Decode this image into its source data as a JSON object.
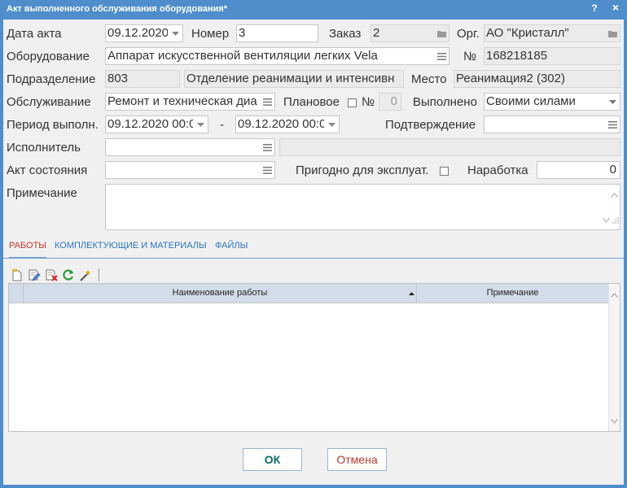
{
  "window": {
    "title": "Акт выполненного обслуживания оборудования*",
    "help": "?",
    "close": "×"
  },
  "labels": {
    "act_date": "Дата акта",
    "number": "Номер",
    "order": "Заказ",
    "org": "Орг.",
    "equipment": "Оборудование",
    "serial_no": "№",
    "department": "Подразделение",
    "place": "Место",
    "service": "Обслуживание",
    "planned": "Плановое",
    "planned_no": "№",
    "performed": "Выполнено",
    "period": "Период выполн.",
    "dash": "-",
    "confirmation": "Подтверждение",
    "executor": "Исполнитель",
    "state_act": "Акт состояния",
    "fit": "Пригодно для эксплуат.",
    "operating_time": "Наработка",
    "note": "Примечание"
  },
  "values": {
    "act_date": "09.12.2020",
    "number": "3",
    "order": "2",
    "org": "АО \"Кристалл\"",
    "equipment": "Аппарат искусственной вентиляции легких Vela",
    "serial_no": "168218185",
    "department_code": "803",
    "department_name": "Отделение  реанимации и интенсивн",
    "place": "Реанимация2 (302)",
    "service": "Ремонт и техническая диа",
    "planned_no": "0",
    "performed": "Своими силами",
    "period_from": "09.12.2020 00:0",
    "period_to": "09.12.2020 00:0",
    "confirmation": "",
    "executor": "",
    "executor_info": "",
    "state_act": "",
    "operating_time": "0",
    "note": "",
    "planned_checked": false,
    "fit_checked": false
  },
  "tabs": [
    {
      "label": "РАБОТЫ",
      "active": true
    },
    {
      "label": "КОМПЛЕКТУЮЩИЕ И МАТЕРИАЛЫ",
      "active": false
    },
    {
      "label": "ФАЙЛЫ",
      "active": false
    }
  ],
  "toolbar_icons": [
    "new-icon",
    "edit-icon",
    "delete-icon",
    "refresh-icon",
    "wand-icon"
  ],
  "grid": {
    "columns": [
      "Наименование работы",
      "Примечание"
    ],
    "rows": []
  },
  "buttons": {
    "ok": "ОК",
    "cancel": "Отмена"
  },
  "colors": {
    "titlebar": "#4f8dcb",
    "accent_tab": "#c0392b",
    "tab": "#2a74c2",
    "header": "#d2dde9"
  }
}
